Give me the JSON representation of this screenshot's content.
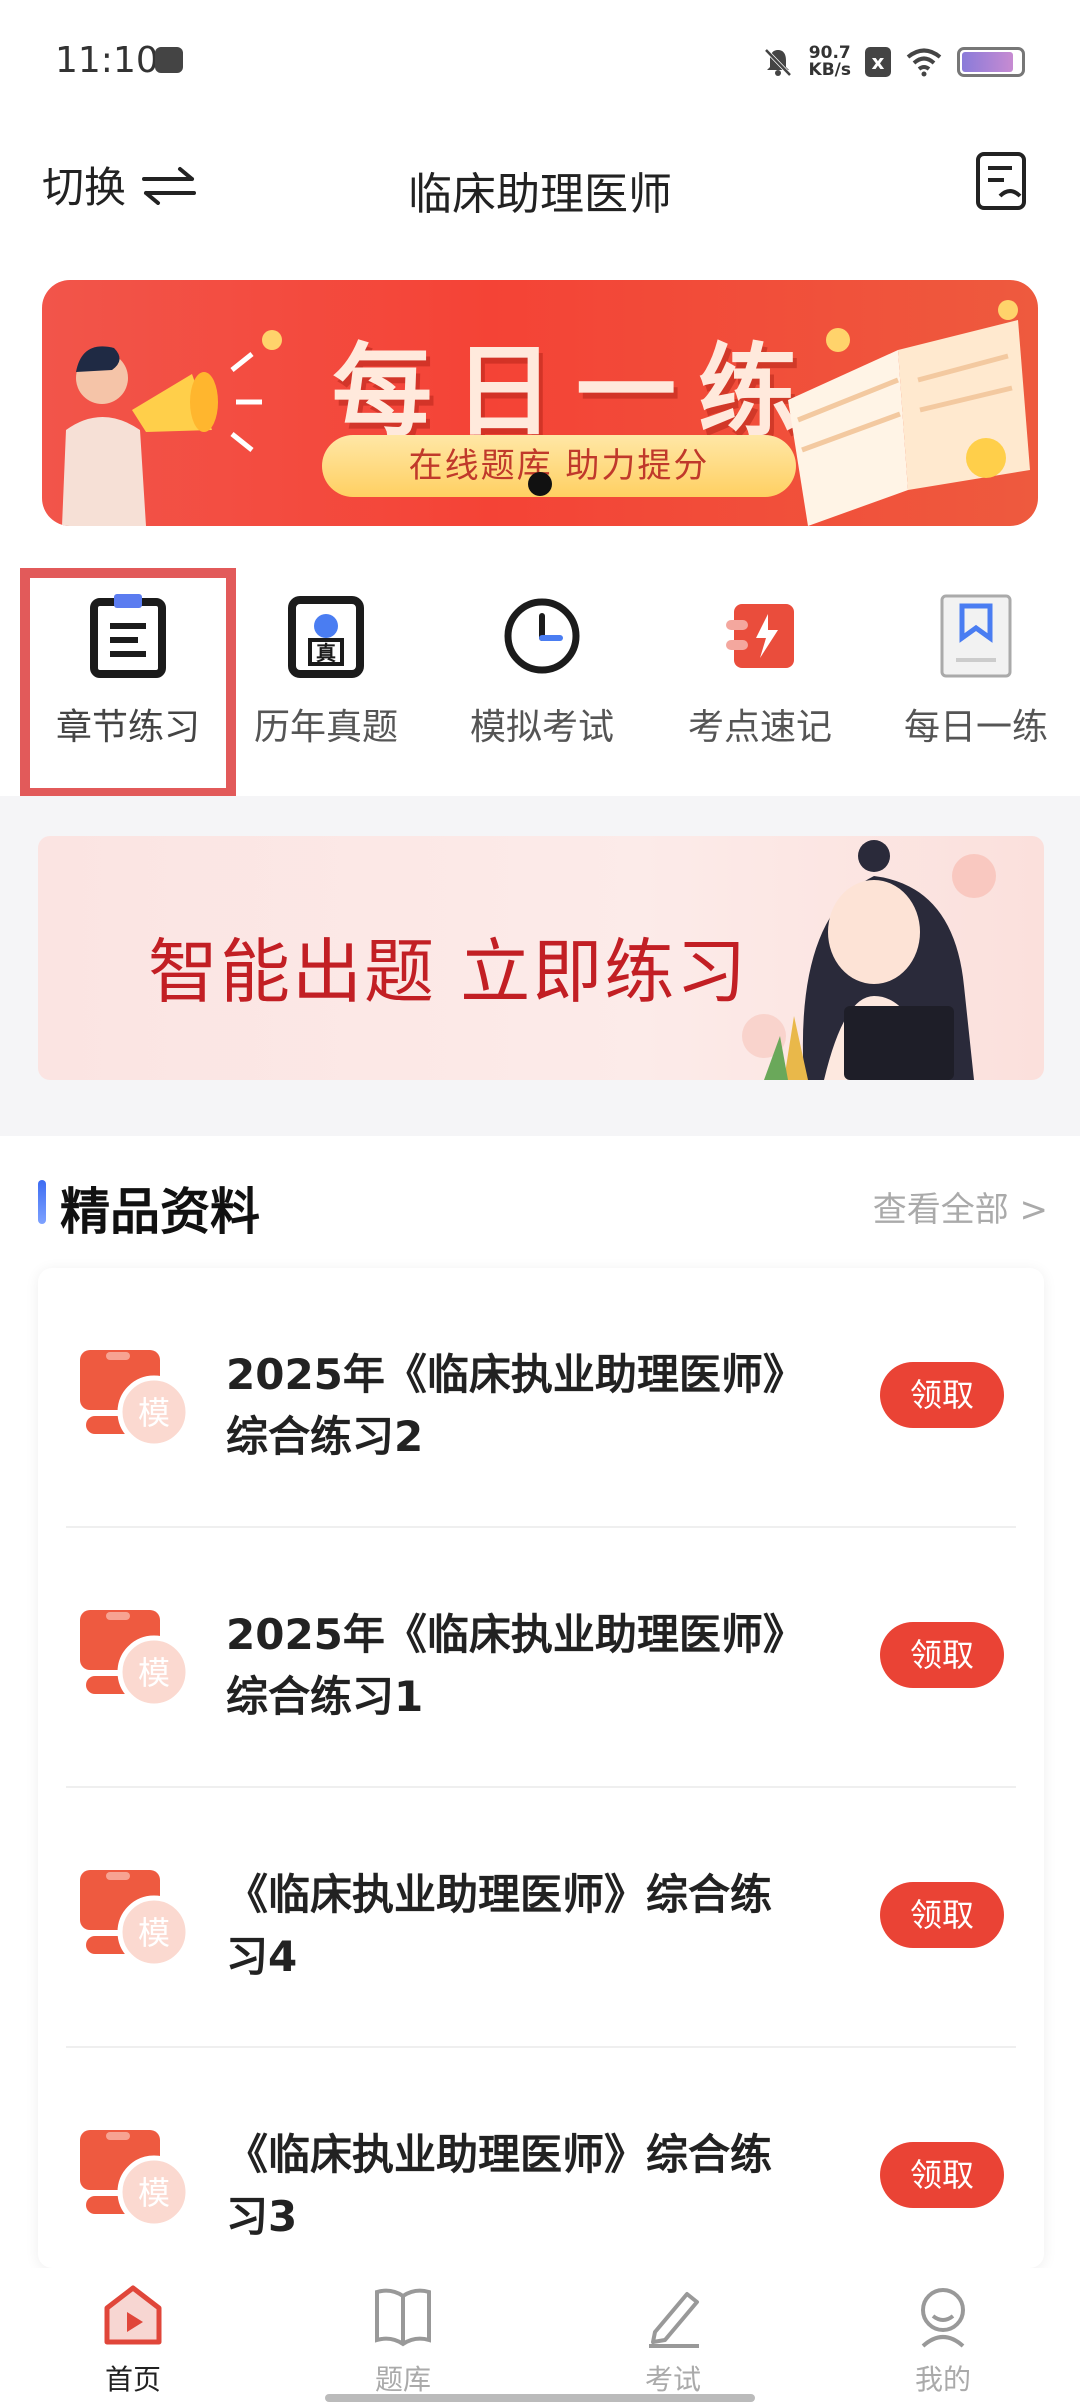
{
  "status_bar": {
    "time": "11:10",
    "net_speed_value": "90.7",
    "net_speed_unit": "KB/s",
    "sim_label": "x"
  },
  "header": {
    "switch_label": "切换",
    "title": "临床助理医师"
  },
  "top_banner": {
    "title": "每日一练",
    "pill_text": "在线题库 助力提分"
  },
  "nav": {
    "items": [
      {
        "label": "章节练习",
        "icon": "chapter-doc-icon"
      },
      {
        "label": "历年真题",
        "icon": "past-exam-icon"
      },
      {
        "label": "模拟考试",
        "icon": "clock-icon"
      },
      {
        "label": "考点速记",
        "icon": "flash-note-icon"
      },
      {
        "label": "每日一练",
        "icon": "bookmark-book-icon"
      }
    ]
  },
  "promo_banner": {
    "text": "智能出题  立即练习"
  },
  "section": {
    "title": "精品资料",
    "more_label": "查看全部 >"
  },
  "materials": {
    "icon_char": "模",
    "items": [
      {
        "title": "2025年《临床执业助理医师》综合练习2",
        "button": "领取"
      },
      {
        "title": "2025年《临床执业助理医师》综合练习1",
        "button": "领取"
      },
      {
        "title": "《临床执业助理医师》综合练习4",
        "button": "领取"
      },
      {
        "title": "《临床执业助理医师》综合练习3",
        "button": "领取"
      }
    ]
  },
  "tabs": [
    {
      "label": "首页",
      "icon": "home-play-icon",
      "active": true
    },
    {
      "label": "题库",
      "icon": "book-icon",
      "active": false
    },
    {
      "label": "考试",
      "icon": "pencil-icon",
      "active": false
    },
    {
      "label": "我的",
      "icon": "profile-icon",
      "active": false
    }
  ],
  "colors": {
    "accent_red": "#ea4335",
    "selection_outline": "#e25a5a",
    "section_bar_blue": "#3d6cf2"
  }
}
